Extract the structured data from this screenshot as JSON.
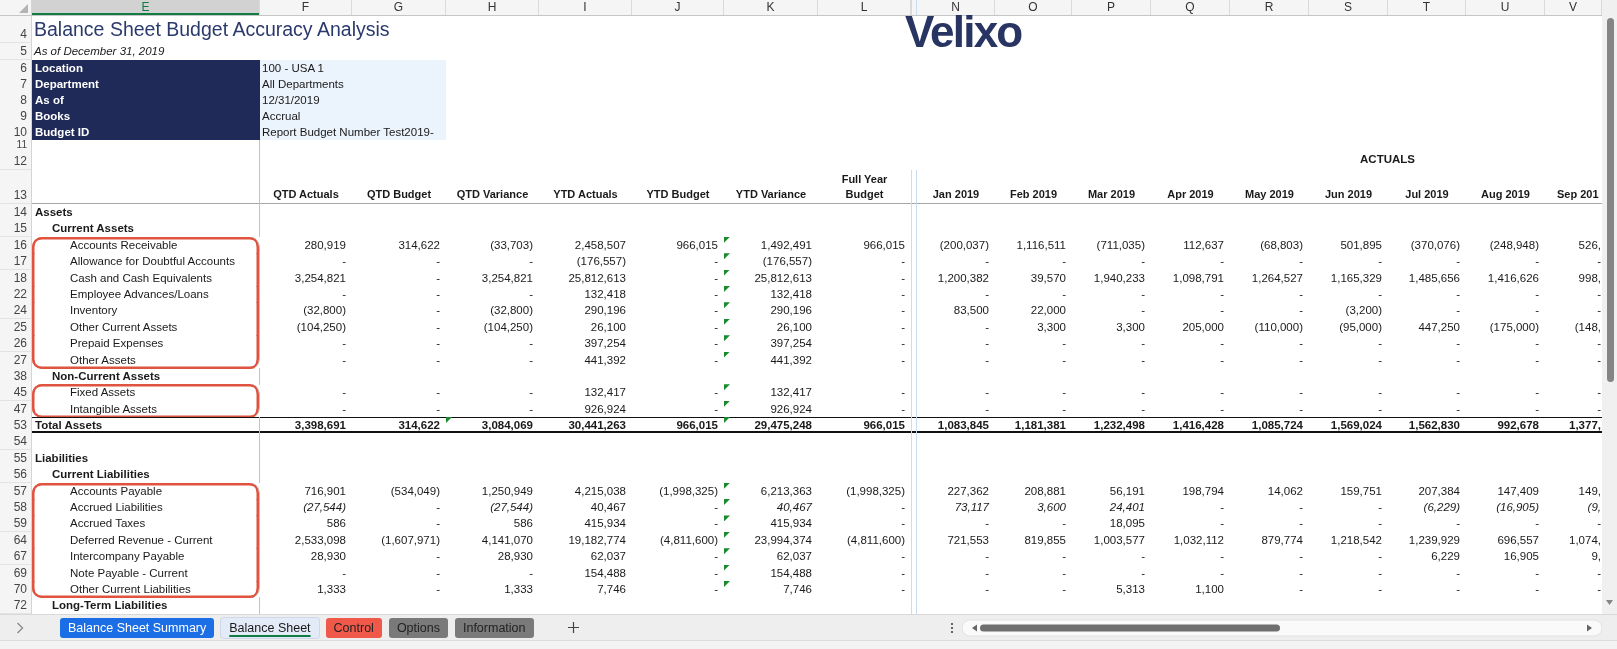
{
  "column_headers": [
    {
      "label": "E",
      "selected": true
    },
    {
      "label": "F",
      "selected": false
    },
    {
      "label": "G",
      "selected": false
    },
    {
      "label": "H",
      "selected": false
    },
    {
      "label": "I",
      "selected": false
    },
    {
      "label": "J",
      "selected": false
    },
    {
      "label": "K",
      "selected": false
    },
    {
      "label": "L",
      "selected": false
    },
    {
      "label": "N",
      "selected": false
    },
    {
      "label": "O",
      "selected": false
    },
    {
      "label": "P",
      "selected": false
    },
    {
      "label": "Q",
      "selected": false
    },
    {
      "label": "R",
      "selected": false
    },
    {
      "label": "S",
      "selected": false
    },
    {
      "label": "T",
      "selected": false
    },
    {
      "label": "U",
      "selected": false
    },
    {
      "label": "V",
      "selected": false
    }
  ],
  "title": {
    "row": "4",
    "text": "Balance Sheet Budget Accuracy Analysis"
  },
  "subtitle": {
    "row": "5",
    "text": "As of December 31, 2019"
  },
  "logo": "Velixo",
  "info": [
    {
      "row": "6",
      "label": "Location",
      "value": "100 - USA 1"
    },
    {
      "row": "7",
      "label": "Department",
      "value": "All Departments"
    },
    {
      "row": "8",
      "label": "As of",
      "value": "12/31/2019"
    },
    {
      "row": "9",
      "label": "Books",
      "value": "Accrual"
    },
    {
      "row": "10",
      "label": "Budget ID",
      "value": "Report Budget Number Test2019-"
    }
  ],
  "spacer_row": "11",
  "band_row": {
    "row": "12",
    "text": "ACTUALS"
  },
  "header_row": {
    "row": "13",
    "titles": [
      "QTD Actuals",
      "QTD Budget",
      "QTD Variance",
      "YTD Actuals",
      "YTD Budget",
      "YTD Variance",
      "Full Year Budget",
      "Jan 2019",
      "Feb 2019",
      "Mar 2019",
      "Apr 2019",
      "May 2019",
      "Jun 2019",
      "Jul 2019",
      "Aug 2019",
      "Sep 201"
    ]
  },
  "rows": [
    {
      "row": "14",
      "kind": "section",
      "label": "Assets",
      "annotated": false
    },
    {
      "row": "15",
      "kind": "subsection",
      "label": "Current Assets",
      "annotated": false
    },
    {
      "row": "16",
      "kind": "line",
      "label": "Accounts Receivable",
      "annotated": true,
      "qtd_variance_flag": false,
      "ytd_variance_flag": true,
      "values": [
        "280,919",
        "314,622",
        "(33,703)",
        "2,458,507",
        "966,015",
        "1,492,491",
        "966,015",
        "(200,037)",
        "1,116,511",
        "(711,035)",
        "112,637",
        "(68,803)",
        "501,895",
        "(370,076)",
        "(248,948)",
        "526,"
      ]
    },
    {
      "row": "17",
      "kind": "line",
      "label": "Allowance for Doubtful Accounts",
      "annotated": true,
      "qtd_variance_flag": false,
      "ytd_variance_flag": true,
      "values": [
        "-",
        "-",
        "-",
        "(176,557)",
        "-",
        "(176,557)",
        "-",
        "-",
        "-",
        "-",
        "-",
        "-",
        "-",
        "-",
        "-",
        "-"
      ]
    },
    {
      "row": "18",
      "kind": "line",
      "label": "Cash and Cash Equivalents",
      "annotated": true,
      "qtd_variance_flag": false,
      "ytd_variance_flag": true,
      "values": [
        "3,254,821",
        "-",
        "3,254,821",
        "25,812,613",
        "-",
        "25,812,613",
        "-",
        "1,200,382",
        "39,570",
        "1,940,233",
        "1,098,791",
        "1,264,527",
        "1,165,329",
        "1,485,656",
        "1,416,626",
        "998,"
      ]
    },
    {
      "row": "22",
      "kind": "line",
      "label": "Employee Advances/Loans",
      "annotated": true,
      "qtd_variance_flag": false,
      "ytd_variance_flag": true,
      "values": [
        "-",
        "-",
        "-",
        "132,418",
        "-",
        "132,418",
        "-",
        "-",
        "-",
        "-",
        "-",
        "-",
        "-",
        "-",
        "-",
        "-"
      ]
    },
    {
      "row": "24",
      "kind": "line",
      "label": "Inventory",
      "annotated": true,
      "qtd_variance_flag": false,
      "ytd_variance_flag": true,
      "values": [
        "(32,800)",
        "-",
        "(32,800)",
        "290,196",
        "-",
        "290,196",
        "-",
        "83,500",
        "22,000",
        "-",
        "-",
        "-",
        "(3,200)",
        "-",
        "-",
        "-"
      ]
    },
    {
      "row": "25",
      "kind": "line",
      "label": "Other Current Assets",
      "annotated": true,
      "qtd_variance_flag": false,
      "ytd_variance_flag": true,
      "values": [
        "(104,250)",
        "-",
        "(104,250)",
        "26,100",
        "-",
        "26,100",
        "-",
        "-",
        "3,300",
        "3,300",
        "205,000",
        "(110,000)",
        "(95,000)",
        "447,250",
        "(175,000)",
        "(148,"
      ]
    },
    {
      "row": "26",
      "kind": "line",
      "label": "Prepaid Expenses",
      "annotated": true,
      "qtd_variance_flag": false,
      "ytd_variance_flag": true,
      "values": [
        "-",
        "-",
        "-",
        "397,254",
        "-",
        "397,254",
        "-",
        "-",
        "-",
        "-",
        "-",
        "-",
        "-",
        "-",
        "-",
        "-"
      ]
    },
    {
      "row": "27",
      "kind": "line",
      "label": "Other Assets",
      "annotated": true,
      "qtd_variance_flag": false,
      "ytd_variance_flag": true,
      "values": [
        "-",
        "-",
        "-",
        "441,392",
        "-",
        "441,392",
        "-",
        "-",
        "-",
        "-",
        "-",
        "-",
        "-",
        "-",
        "-",
        "-"
      ]
    },
    {
      "row": "38",
      "kind": "subsection",
      "label": "Non-Current Assets",
      "annotated": false
    },
    {
      "row": "45",
      "kind": "line",
      "label": "Fixed Assets",
      "annotated": true,
      "qtd_variance_flag": false,
      "ytd_variance_flag": true,
      "values": [
        "-",
        "-",
        "-",
        "132,417",
        "-",
        "132,417",
        "-",
        "-",
        "-",
        "-",
        "-",
        "-",
        "-",
        "-",
        "-",
        "-"
      ]
    },
    {
      "row": "47",
      "kind": "line",
      "label": "Intangible Assets",
      "annotated": true,
      "qtd_variance_flag": false,
      "ytd_variance_flag": true,
      "values": [
        "-",
        "-",
        "-",
        "926,924",
        "-",
        "926,924",
        "-",
        "-",
        "-",
        "-",
        "-",
        "-",
        "-",
        "-",
        "-",
        "-"
      ]
    },
    {
      "row": "53",
      "kind": "total",
      "label": "Total Assets",
      "annotated": false,
      "qtd_variance_flag": true,
      "ytd_variance_flag": true,
      "values": [
        "3,398,691",
        "314,622",
        "3,084,069",
        "30,441,263",
        "966,015",
        "29,475,248",
        "966,015",
        "1,083,845",
        "1,181,381",
        "1,232,498",
        "1,416,428",
        "1,085,724",
        "1,569,024",
        "1,562,830",
        "992,678",
        "1,377,"
      ]
    },
    {
      "row": "54",
      "kind": "blank",
      "annotated": false
    },
    {
      "row": "55",
      "kind": "section",
      "label": "Liabilities",
      "annotated": false
    },
    {
      "row": "56",
      "kind": "subsection",
      "label": "Current Liabilities",
      "annotated": false
    },
    {
      "row": "57",
      "kind": "line",
      "label": "Accounts Payable",
      "annotated": true,
      "qtd_variance_flag": false,
      "ytd_variance_flag": true,
      "values": [
        "716,901",
        "(534,049)",
        "1,250,949",
        "4,215,038",
        "(1,998,325)",
        "6,213,363",
        "(1,998,325)",
        "227,362",
        "208,881",
        "56,191",
        "198,794",
        "14,062",
        "159,751",
        "207,384",
        "147,409",
        "149,"
      ]
    },
    {
      "row": "58",
      "kind": "line",
      "label": "Accrued Liabilities",
      "annotated": true,
      "qtd_variance_flag": false,
      "ytd_variance_flag": true,
      "values": [
        "(27,544)",
        "-",
        "(27,544)",
        "40,467",
        "-",
        "40,467",
        "-",
        "73,117",
        "3,600",
        "24,401",
        "-",
        "-",
        "-",
        "(6,229)",
        "(16,905)",
        "(9,"
      ],
      "italic": [
        true,
        false,
        true,
        false,
        false,
        true,
        false,
        true,
        true,
        true,
        false,
        false,
        false,
        true,
        true,
        true
      ]
    },
    {
      "row": "59",
      "kind": "line",
      "label": "Accrued Taxes",
      "annotated": true,
      "qtd_variance_flag": false,
      "ytd_variance_flag": true,
      "values": [
        "586",
        "-",
        "586",
        "415,934",
        "-",
        "415,934",
        "-",
        "-",
        "-",
        "18,095",
        "-",
        "-",
        "-",
        "-",
        "-",
        "-"
      ]
    },
    {
      "row": "64",
      "kind": "line",
      "label": "Deferred Revenue - Current",
      "annotated": true,
      "qtd_variance_flag": false,
      "ytd_variance_flag": true,
      "values": [
        "2,533,098",
        "(1,607,971)",
        "4,141,070",
        "19,182,774",
        "(4,811,600)",
        "23,994,374",
        "(4,811,600)",
        "721,553",
        "819,855",
        "1,003,577",
        "1,032,112",
        "879,774",
        "1,218,542",
        "1,239,929",
        "696,557",
        "1,074,"
      ]
    },
    {
      "row": "67",
      "kind": "line",
      "label": "Intercompany Payable",
      "annotated": true,
      "qtd_variance_flag": false,
      "ytd_variance_flag": true,
      "values": [
        "28,930",
        "-",
        "28,930",
        "62,037",
        "-",
        "62,037",
        "-",
        "-",
        "-",
        "-",
        "-",
        "-",
        "-",
        "6,229",
        "16,905",
        "9,"
      ]
    },
    {
      "row": "69",
      "kind": "line",
      "label": "Note Payable - Current",
      "annotated": true,
      "qtd_variance_flag": false,
      "ytd_variance_flag": true,
      "values": [
        "-",
        "-",
        "-",
        "154,488",
        "-",
        "154,488",
        "-",
        "-",
        "-",
        "-",
        "-",
        "-",
        "-",
        "-",
        "-",
        "-"
      ]
    },
    {
      "row": "70",
      "kind": "line",
      "label": "Other Current Liabilities",
      "annotated": true,
      "qtd_variance_flag": false,
      "ytd_variance_flag": true,
      "values": [
        "1,333",
        "-",
        "1,333",
        "7,746",
        "-",
        "7,746",
        "-",
        "-",
        "-",
        "5,313",
        "1,100",
        "-",
        "-",
        "-",
        "-",
        "-"
      ]
    },
    {
      "row": "72",
      "kind": "subsection",
      "label": "Long-Term Liabilities",
      "annotated": false
    }
  ],
  "sheet_tabs": [
    {
      "label": "Balance Sheet Summary",
      "selected": false,
      "color": "#1b6ee6"
    },
    {
      "label": "Balance Sheet",
      "selected": true,
      "color": "#e3eaf8"
    },
    {
      "label": "Control",
      "selected": false,
      "color": "#f0594a"
    },
    {
      "label": "Options",
      "selected": false,
      "color": "#7a7a7a"
    },
    {
      "label": "Information",
      "selected": false,
      "color": "#7a7a7a"
    }
  ]
}
